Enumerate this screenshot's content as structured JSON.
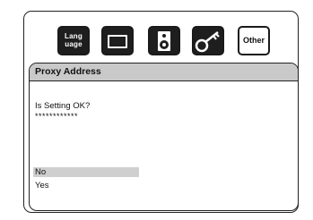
{
  "tabs": [
    {
      "icon": "language-icon",
      "label": "Lang\nuage"
    },
    {
      "icon": "tv-icon"
    },
    {
      "icon": "speaker-icon"
    },
    {
      "icon": "key-icon"
    },
    {
      "icon": "other-icon",
      "label": "Other"
    }
  ],
  "panel": {
    "title": "Proxy Address",
    "question": "Is Setting OK?",
    "masked_value": "************",
    "options": [
      {
        "label": "No",
        "selected": true
      },
      {
        "label": "Yes",
        "selected": false
      }
    ]
  },
  "colors": {
    "tab_dark": "#1e1e1e",
    "title_bar": "#c9c9c9",
    "selected_bg": "#cfcfcf"
  }
}
